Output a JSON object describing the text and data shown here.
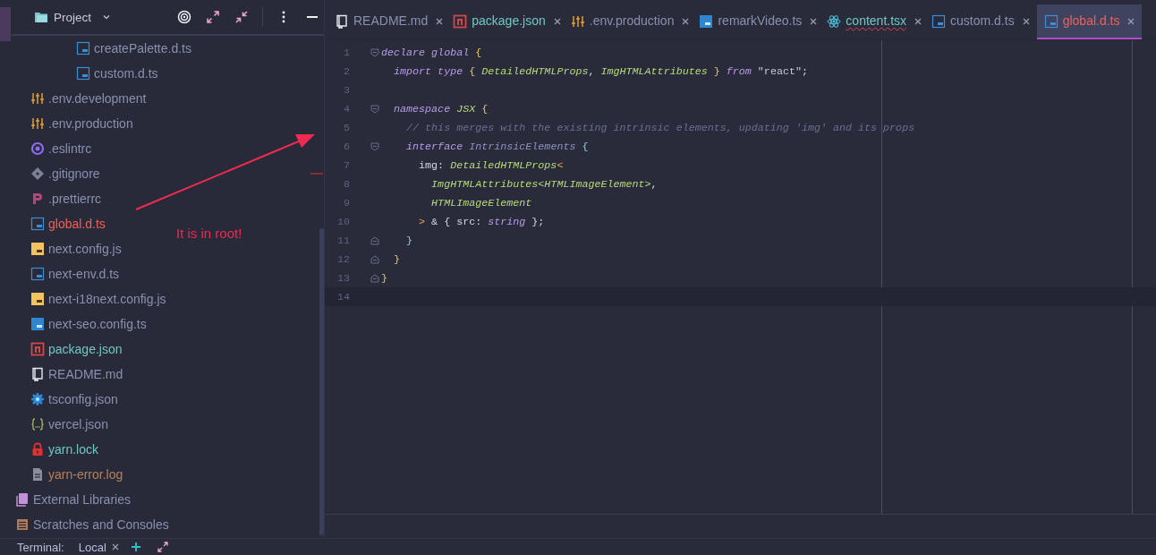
{
  "project_panel": {
    "title": "Project",
    "tree": [
      {
        "children": [
          {
            "children": [
              {
                "children": [
                  {
                    "children": [
                      {
                        "name": "createPalette.d.ts",
                        "kind": "ts",
                        "color": "#8a90b0"
                      },
                      {
                        "name": "custom.d.ts",
                        "kind": "ts",
                        "color": "#8a90b0"
                      }
                    ]
                  }
                ]
              }
            ]
          },
          {
            "name": ".env.development",
            "kind": "env",
            "color": "#8a90b0"
          },
          {
            "name": ".env.production",
            "kind": "env",
            "color": "#8a90b0"
          },
          {
            "name": ".eslintrc",
            "kind": "eslint",
            "color": "#8a90b0"
          },
          {
            "name": ".gitignore",
            "kind": "git",
            "color": "#8a90b0"
          },
          {
            "name": ".prettierrc",
            "kind": "prettier",
            "color": "#8a90b0"
          },
          {
            "name": "global.d.ts",
            "kind": "ts",
            "color": "#f06058"
          },
          {
            "name": "next.config.js",
            "kind": "js",
            "color": "#8a90b0"
          },
          {
            "name": "next-env.d.ts",
            "kind": "ts",
            "color": "#8a90b0"
          },
          {
            "name": "next-i18next.config.js",
            "kind": "js",
            "color": "#8a90b0"
          },
          {
            "name": "next-seo.config.ts",
            "kind": "tssolid",
            "color": "#8a90b0"
          },
          {
            "name": "package.json",
            "kind": "npm",
            "color": "#6fc8c0"
          },
          {
            "name": "README.md",
            "kind": "readme",
            "color": "#8a90b0"
          },
          {
            "name": "tsconfig.json",
            "kind": "tsconfig",
            "color": "#8a90b0"
          },
          {
            "name": "vercel.json",
            "kind": "json",
            "color": "#8a90b0"
          },
          {
            "name": "yarn.lock",
            "kind": "lock",
            "color": "#6fc8c0"
          },
          {
            "name": "yarn-error.log",
            "kind": "log",
            "color": "#b8805a"
          }
        ]
      },
      {
        "name": "External Libraries",
        "kind": "libraries",
        "color": "#8a90b0"
      },
      {
        "name": "Scratches and Consoles",
        "kind": "scratches",
        "color": "#8a90b0"
      }
    ]
  },
  "editor": {
    "tabs": [
      {
        "label": "README.md",
        "kind": "readme",
        "color": "#8a90b0",
        "error": false,
        "selected": false
      },
      {
        "label": "package.json",
        "kind": "npm",
        "color": "#6fc8c0",
        "error": false,
        "selected": false
      },
      {
        "label": ".env.production",
        "kind": "env",
        "color": "#8a90b0",
        "error": false,
        "selected": false
      },
      {
        "label": "remarkVideo.ts",
        "kind": "tssolid",
        "color": "#8a90b0",
        "error": false,
        "selected": false
      },
      {
        "label": "content.tsx",
        "kind": "react",
        "color": "#6fc8c0",
        "error": true,
        "selected": false
      },
      {
        "label": "custom.d.ts",
        "kind": "ts",
        "color": "#8a90b0",
        "error": false,
        "selected": false
      },
      {
        "label": "global.d.ts",
        "kind": "ts",
        "color": "#f06058",
        "error": false,
        "selected": true
      }
    ],
    "lines": [
      {
        "number": "1",
        "kind": "foldstart",
        "current": false,
        "tokens": [
          {
            "kind": "keyword",
            "text": "declare "
          },
          {
            "kind": "keyword",
            "text": "global "
          },
          {
            "kind": "brace",
            "text": "{"
          }
        ]
      },
      {
        "number": "2",
        "current": false,
        "tokens": [
          {
            "kind": "keyword",
            "text": "  import type "
          },
          {
            "kind": "brace",
            "text": "{ "
          },
          {
            "kind": "type",
            "text": "DetailedHTMLProps"
          },
          {
            "kind": "plain",
            "text": ", "
          },
          {
            "kind": "type",
            "text": "ImgHTMLAttributes"
          },
          {
            "kind": "brace",
            "text": " } "
          },
          {
            "kind": "keyword",
            "text": "from "
          },
          {
            "kind": "string",
            "text": "\"react\""
          },
          {
            "kind": "plain",
            "text": ";"
          }
        ]
      },
      {
        "number": "3",
        "current": false
      },
      {
        "number": "4",
        "kind": "foldstart",
        "current": false,
        "tokens": [
          {
            "kind": "keyword",
            "text": "  namespace "
          },
          {
            "kind": "type",
            "text": "JSX "
          },
          {
            "kind": "brace",
            "text": "{"
          }
        ]
      },
      {
        "number": "5",
        "current": false,
        "tokens": [
          {
            "kind": "comment",
            "text": "    // this merges with the existing intrinsic elements, updating 'img' and its props"
          }
        ]
      },
      {
        "number": "6",
        "kind": "foldstart",
        "current": false,
        "tokens": [
          {
            "kind": "keyword",
            "text": "    interface "
          },
          {
            "kind": "interface",
            "text": "IntrinsicElements "
          },
          {
            "kind": "brace2",
            "text": "{"
          }
        ]
      },
      {
        "number": "7",
        "current": false,
        "tokens": [
          {
            "kind": "plain",
            "text": "      img: "
          },
          {
            "kind": "type",
            "text": "DetailedHTMLProps"
          },
          {
            "kind": "operator",
            "text": "<"
          }
        ]
      },
      {
        "number": "8",
        "current": false,
        "tokens": [
          {
            "kind": "type",
            "text": "        ImgHTMLAttributes<HTMLImageElement>"
          },
          {
            "kind": "plain",
            "text": ","
          }
        ]
      },
      {
        "number": "9",
        "current": false,
        "tokens": [
          {
            "kind": "type",
            "text": "        HTMLImageElement"
          }
        ]
      },
      {
        "number": "10",
        "current": false,
        "tokens": [
          {
            "kind": "operator",
            "text": "      > "
          },
          {
            "kind": "plain",
            "text": "& { src: "
          },
          {
            "kind": "keyword",
            "text": "string"
          },
          {
            "kind": "plain",
            "text": " };"
          }
        ]
      },
      {
        "number": "11",
        "kind": "foldend",
        "current": false,
        "tokens": [
          {
            "kind": "brace2",
            "text": "    }"
          }
        ]
      },
      {
        "number": "12",
        "kind": "foldend",
        "current": false,
        "tokens": [
          {
            "kind": "brace",
            "text": "  }"
          }
        ]
      },
      {
        "number": "13",
        "kind": "foldend",
        "current": false,
        "tokens": [
          {
            "kind": "brace",
            "text": "}"
          }
        ]
      },
      {
        "number": "14",
        "current": true
      }
    ]
  },
  "annotation": {
    "text": "It is in root!"
  },
  "terminal_bar": {
    "label": "Terminal:",
    "tabs": [
      {
        "label": "Local",
        "selected": true
      }
    ]
  }
}
